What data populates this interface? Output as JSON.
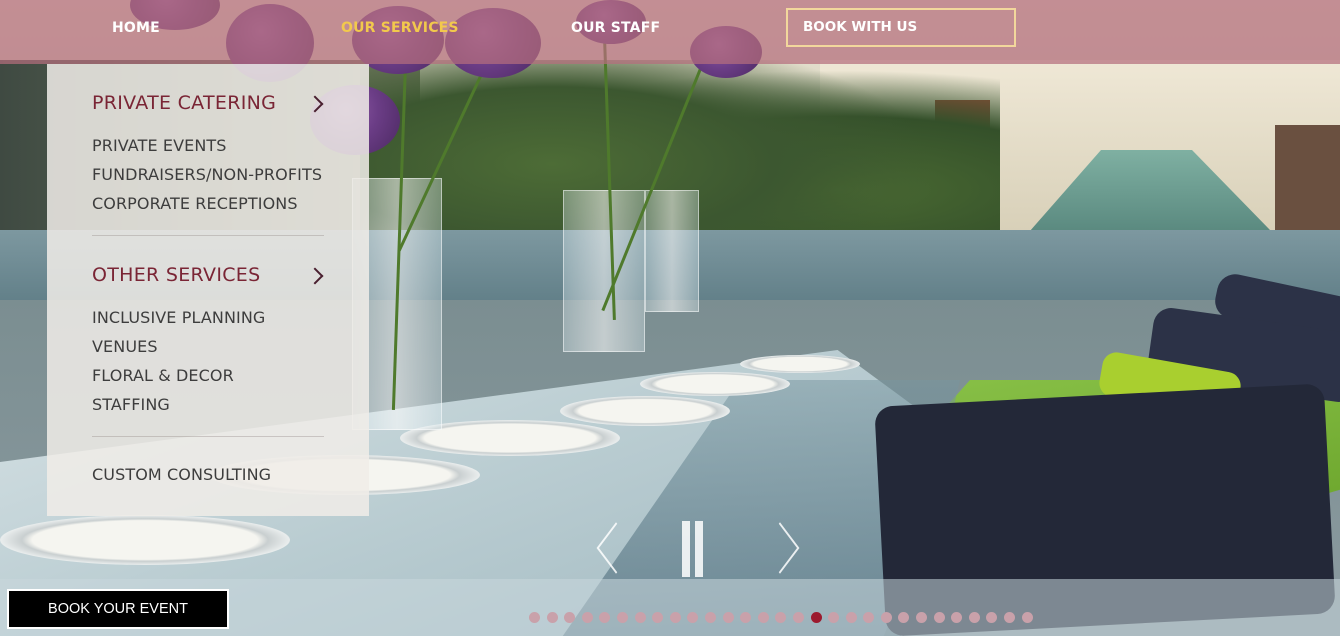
{
  "nav": {
    "home": "HOME",
    "services": "OUR SERVICES",
    "staff": "OUR STAFF",
    "book": "BOOK WITH US",
    "active_item": "services",
    "active_color": "#f2c94c"
  },
  "dropdown": {
    "sections": [
      {
        "heading": "PRIVATE CATERING",
        "items": [
          "PRIVATE EVENTS",
          "FUNDRAISERS/NON-PROFITS",
          "CORPORATE RECEPTIONS"
        ]
      },
      {
        "heading": "OTHER SERVICES",
        "items": [
          "INCLUSIVE PLANNING",
          "VENUES",
          "FLORAL & DECOR",
          "STAFFING"
        ]
      },
      {
        "heading": "",
        "items": [
          "CUSTOM CONSULTING"
        ]
      }
    ],
    "heading_color": "#7a2535"
  },
  "slider": {
    "prev_icon": "chevron-left-icon",
    "next_icon": "chevron-right-icon",
    "pause_icon": "pause-icon",
    "dot_count": 29,
    "active_dot": 16,
    "active_dot_color": "#9c1a2e"
  },
  "cta": {
    "book_event": "BOOK YOUR EVENT"
  }
}
